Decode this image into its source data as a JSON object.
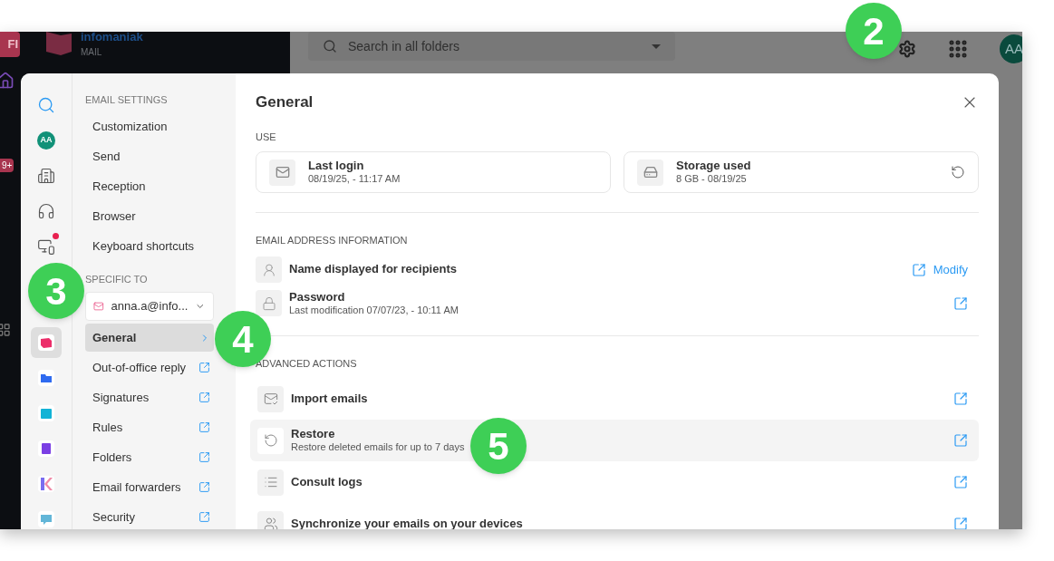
{
  "left_strip": {
    "app_badge": "FI",
    "unread_count": "9+"
  },
  "app_bar": {
    "logo": {
      "name": "infomaniak",
      "product": "MAIL"
    },
    "search": {
      "placeholder": "Search in all folders"
    },
    "avatar": "AA"
  },
  "settings_rail": [
    {
      "kind": "search",
      "selected": false,
      "notification": false
    },
    {
      "kind": "avatar",
      "initials": "AA",
      "selected": false,
      "notification": false
    },
    {
      "kind": "building",
      "selected": false,
      "notification": false
    },
    {
      "kind": "support",
      "selected": false,
      "notification": false
    },
    {
      "kind": "devices",
      "selected": false,
      "notification": true
    },
    {
      "kind": "mail",
      "selected": true,
      "notification": false
    },
    {
      "kind": "drive",
      "selected": false,
      "notification": false
    },
    {
      "kind": "calendar",
      "selected": false,
      "notification": false
    },
    {
      "kind": "book",
      "selected": false,
      "notification": false
    },
    {
      "kind": "suite",
      "selected": false,
      "notification": false
    },
    {
      "kind": "chat",
      "selected": false,
      "notification": false
    }
  ],
  "menu": {
    "sections": [
      {
        "heading": "EMAIL SETTINGS",
        "items": [
          {
            "label": "Customization",
            "kind": "internal",
            "selected": false
          },
          {
            "label": "Send",
            "kind": "internal",
            "selected": false
          },
          {
            "label": "Reception",
            "kind": "internal",
            "selected": false
          },
          {
            "label": "Browser",
            "kind": "internal",
            "selected": false
          },
          {
            "label": "Keyboard shortcuts",
            "kind": "internal",
            "selected": false
          }
        ]
      },
      {
        "heading": "SPECIFIC TO",
        "account": "anna.a@info...",
        "items": [
          {
            "label": "General",
            "kind": "internal",
            "selected": true
          },
          {
            "label": "Out-of-office reply",
            "kind": "external",
            "selected": false
          },
          {
            "label": "Signatures",
            "kind": "external",
            "selected": false
          },
          {
            "label": "Rules",
            "kind": "external",
            "selected": false
          },
          {
            "label": "Folders",
            "kind": "external",
            "selected": false
          },
          {
            "label": "Email forwarders",
            "kind": "external",
            "selected": false
          },
          {
            "label": "Security",
            "kind": "external",
            "selected": false
          }
        ]
      }
    ]
  },
  "content": {
    "title": "General",
    "use": {
      "heading": "USE",
      "cards": [
        {
          "title": "Last login",
          "detail": "08/19/25, - 11:17 AM",
          "refresh": false
        },
        {
          "title": "Storage used",
          "detail": "8 GB - 08/19/25",
          "refresh": true
        }
      ]
    },
    "address_info": {
      "heading": "EMAIL ADDRESS INFORMATION",
      "rows": [
        {
          "title": "Name displayed for recipients",
          "action": "Modify"
        },
        {
          "title": "Password",
          "detail": "Last modification 07/07/23, - 10:11 AM"
        }
      ]
    },
    "advanced": {
      "heading": "ADVANCED ACTIONS",
      "rows": [
        {
          "title": "Import emails",
          "highlighted": false
        },
        {
          "title": "Restore",
          "detail": "Restore deleted emails for up to 7 days",
          "highlighted": true
        },
        {
          "title": "Consult logs",
          "highlighted": false
        },
        {
          "title": "Synchronize your emails on your devices",
          "highlighted": false
        }
      ]
    }
  },
  "callouts": [
    {
      "number": "2"
    },
    {
      "number": "3"
    },
    {
      "number": "4"
    },
    {
      "number": "5"
    }
  ]
}
